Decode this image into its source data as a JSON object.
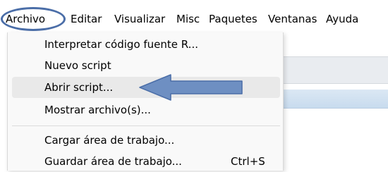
{
  "menubar": {
    "items": [
      {
        "label": "Archivo"
      },
      {
        "label": "Editar"
      },
      {
        "label": "Visualizar"
      },
      {
        "label": "Misc"
      },
      {
        "label": "Paquetes"
      },
      {
        "label": "Ventanas"
      },
      {
        "label": "Ayuda"
      }
    ]
  },
  "archivo_menu": {
    "items": [
      {
        "label": "Interpretar código fuente R..."
      },
      {
        "label": "Nuevo script"
      },
      {
        "label": "Abrir script..."
      },
      {
        "label": "Mostrar archivo(s)..."
      },
      {
        "label": "Cargar área de trabajo..."
      },
      {
        "label": "Guardar  área de trabajo...",
        "shortcut": "Ctrl+S"
      }
    ]
  },
  "colors": {
    "annotation": "#6e8fc2",
    "annotation_outline": "#4b6ea8",
    "hover": "#e9e9e9"
  }
}
